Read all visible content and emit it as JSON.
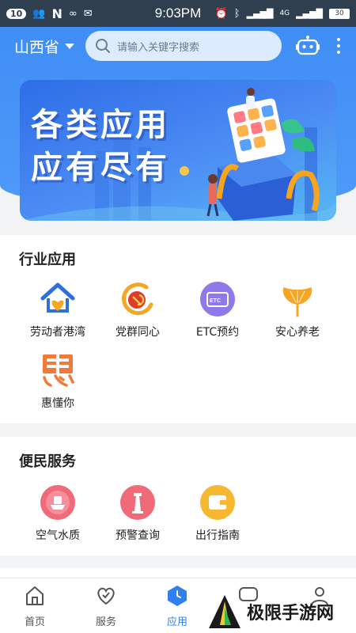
{
  "status_bar": {
    "badge": "10",
    "time": "9:03PM",
    "network": "4G",
    "battery": "30"
  },
  "header": {
    "province": "山西省",
    "search_placeholder": "请输入关键字搜索"
  },
  "banner": {
    "line1": "各类应用",
    "line2": "应有尽有"
  },
  "industry": {
    "title": "行业应用",
    "apps": [
      {
        "label": "劳动者港湾",
        "icon": "worker-harbor-icon"
      },
      {
        "label": "党群同心",
        "icon": "party-emblem-icon"
      },
      {
        "label": "ETC预约",
        "icon": "etc-card-icon"
      },
      {
        "label": "安心养老",
        "icon": "ginkgo-leaf-icon"
      },
      {
        "label": "惠懂你",
        "icon": "hui-character-icon"
      }
    ]
  },
  "convenience": {
    "title": "便民服务",
    "apps": [
      {
        "label": "空气水质",
        "icon": "air-water-icon"
      },
      {
        "label": "预警查询",
        "icon": "lighthouse-icon"
      },
      {
        "label": "出行指南",
        "icon": "wallet-icon"
      }
    ]
  },
  "tabbar": {
    "tabs": [
      {
        "label": "首页",
        "icon": "home-icon"
      },
      {
        "label": "服务",
        "icon": "heart-icon"
      },
      {
        "label": "应用",
        "icon": "app-hexagon-icon"
      }
    ],
    "active_color": "#2f7ff0"
  },
  "watermark": {
    "text": "极限手游网"
  },
  "colors": {
    "header_blue": "#3f8ef6",
    "status_bar": "#2f3f4f"
  }
}
